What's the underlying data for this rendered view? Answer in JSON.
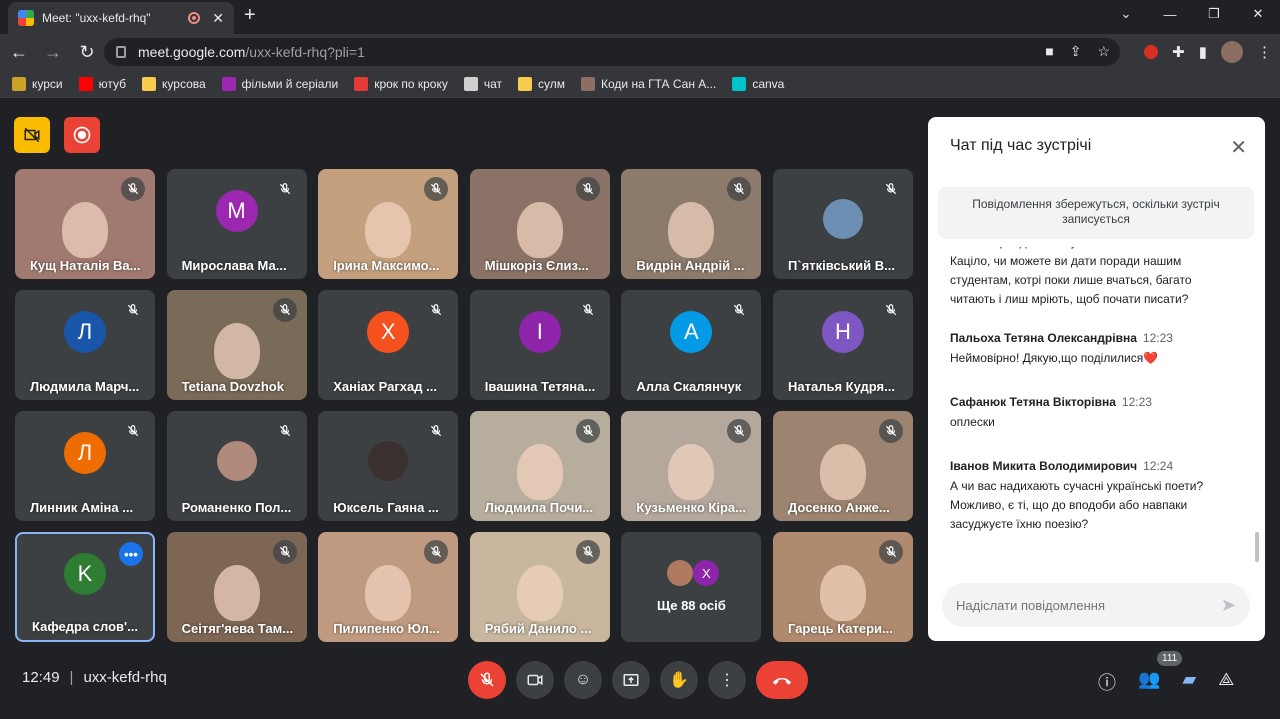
{
  "browser": {
    "tab_title": "Meet: \"uxx-kefd-rhq\"",
    "url_host": "meet.google.com",
    "url_path": "/uxx-kefd-rhq?pli=1",
    "bookmarks": [
      {
        "label": "курси",
        "color": "#c9a227"
      },
      {
        "label": "ютуб",
        "color": "#ff0000"
      },
      {
        "label": "курсова",
        "color": "#f7cb4d"
      },
      {
        "label": "фільми й серіали",
        "color": "#9c27b0"
      },
      {
        "label": "крок по кроку",
        "color": "#e53935"
      },
      {
        "label": "чат",
        "color": "#cfcfcf"
      },
      {
        "label": "сулм",
        "color": "#f7cb4d"
      },
      {
        "label": "Коди на ГТА Сан А...",
        "color": "#8d6e63"
      },
      {
        "label": "canva",
        "color": "#00c4cc"
      }
    ]
  },
  "tiles": [
    {
      "name": "Кущ Наталія Ва...",
      "type": "video",
      "bg": "#a07a70"
    },
    {
      "name": "Мирослава Ма...",
      "type": "avatar",
      "letter": "M",
      "color": "#9c27b0"
    },
    {
      "name": "Ірина Максимо...",
      "type": "video",
      "bg": "#c4a07e"
    },
    {
      "name": "Мішкоріз Єлиз...",
      "type": "video",
      "bg": "#8a7366"
    },
    {
      "name": "Видрін Андрій ...",
      "type": "video",
      "bg": "#8c7a6b"
    },
    {
      "name": "П`ятківський В...",
      "type": "photo",
      "color": "#6d8fb3"
    },
    {
      "name": "Людмила Марч...",
      "type": "avatar",
      "letter": "Л",
      "color": "#1a56a8"
    },
    {
      "name": "Tetiana Dovzhok",
      "type": "video",
      "bg": "#7a6a58"
    },
    {
      "name": "Ханіах Рагхад ...",
      "type": "avatar",
      "letter": "Х",
      "color": "#f4511e"
    },
    {
      "name": "Івашина Тетяна...",
      "type": "avatar",
      "letter": "I",
      "color": "#8e24aa"
    },
    {
      "name": "Алла Скалянчук",
      "type": "avatar",
      "letter": "А",
      "color": "#039be5"
    },
    {
      "name": "Наталья Кудря...",
      "type": "avatar",
      "letter": "Н",
      "color": "#7e57c2"
    },
    {
      "name": "Линник Аміна ...",
      "type": "avatar",
      "letter": "Л",
      "color": "#ef6c00"
    },
    {
      "name": "Романенко Пол...",
      "type": "photo",
      "color": "#b08a7a"
    },
    {
      "name": "Юксель Гаяна ...",
      "type": "photo",
      "color": "#3a3030"
    },
    {
      "name": "Людмила Почи...",
      "type": "video",
      "bg": "#b6ad9c"
    },
    {
      "name": "Кузьменко Кіра...",
      "type": "video",
      "bg": "#b4a89c"
    },
    {
      "name": "Досенко Анже...",
      "type": "video",
      "bg": "#9c8470"
    },
    {
      "name": "Кафедра слов'...",
      "type": "avatar",
      "letter": "K",
      "color": "#2e7d32",
      "selected": true
    },
    {
      "name": "Сеітяг'яева Там...",
      "type": "video",
      "bg": "#7d6654"
    },
    {
      "name": "Пилипенко Юл...",
      "type": "video",
      "bg": "#c09a80"
    },
    {
      "name": "Рябий Данило ...",
      "type": "video",
      "bg": "#c8b69e"
    },
    {
      "name": "Ще 88 осіб",
      "type": "more"
    },
    {
      "name": "Гарець Катери...",
      "type": "video",
      "bg": "#b08a6e"
    }
  ],
  "chat": {
    "title": "Чат під час зустрічі",
    "note": "Повідомлення збережуться, оскільки зустріч записується",
    "messages": [
      {
        "author": "",
        "time": "",
        "text": "стати в прийдешньому письменниками. Пане Каціло, чи можете ви дати поради нашим студентам, котрі поки лише вчаться, багато читають і лиш мріють, щоб почати писати?"
      },
      {
        "author": "Пальоха Тетяна Олександрівна",
        "time": "12:23",
        "text": "Неймовірно! Дякую,що поділилися❤️"
      },
      {
        "author": "Сафанюк Тетяна Вікторівна",
        "time": "12:23",
        "text": "оплески"
      },
      {
        "author": "Іванов Микита Володимирович",
        "time": "12:24",
        "text": "А чи вас надихають сучасні українські поети? Можливо, є ті, що до вподоби або навпаки засуджуєте їхню поезію?"
      }
    ],
    "input_placeholder": "Надіслати повідомлення"
  },
  "bottom": {
    "time": "12:49",
    "separator": "|",
    "code": "uxx-kefd-rhq",
    "participants_count": "111"
  }
}
